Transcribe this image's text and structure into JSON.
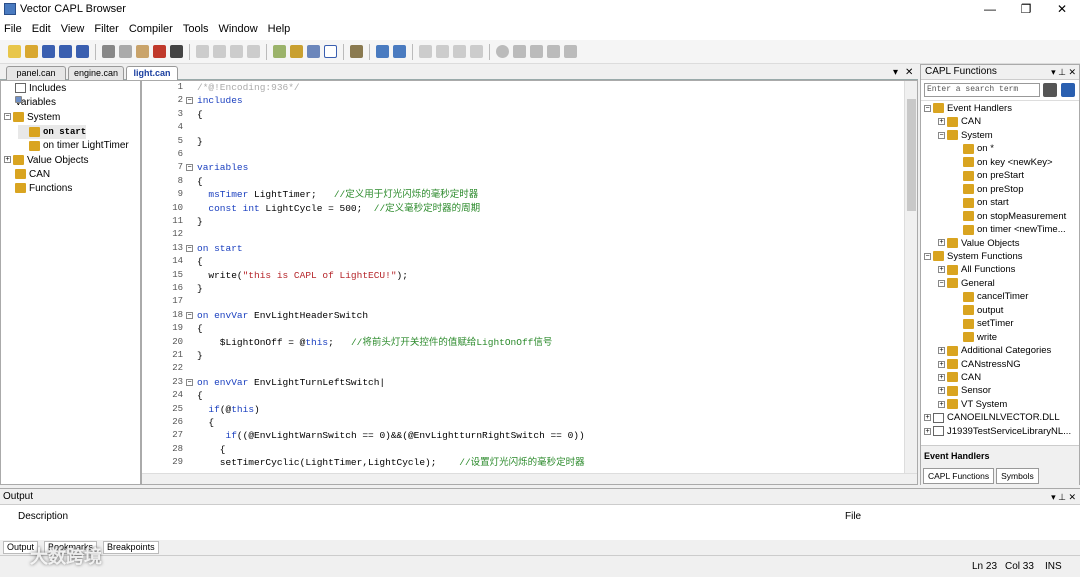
{
  "window": {
    "title": "Vector CAPL Browser",
    "controls": [
      "—",
      "❐",
      "✕"
    ]
  },
  "menu": [
    "File",
    "Edit",
    "View",
    "Filter",
    "Compiler",
    "Tools",
    "Window",
    "Help"
  ],
  "tabs": [
    {
      "label": "panel.can",
      "active": false
    },
    {
      "label": "engine.can",
      "active": false
    },
    {
      "label": "light.can",
      "active": true
    }
  ],
  "tab_controls": {
    "dropdown": "▾",
    "close": "✕"
  },
  "left_tree": [
    {
      "label": "Includes",
      "depth": 0,
      "exp": "",
      "icon": "doc"
    },
    {
      "label": "Variables",
      "depth": 0,
      "exp": "",
      "icon": "fold"
    },
    {
      "label": "System",
      "depth": 0,
      "exp": "−",
      "icon": "fx"
    },
    {
      "label": "on start",
      "depth": 1,
      "exp": "",
      "icon": "fx",
      "bold": true,
      "sel": true
    },
    {
      "label": "on timer LightTimer",
      "depth": 1,
      "exp": "",
      "icon": "fx"
    },
    {
      "label": "Value Objects",
      "depth": 0,
      "exp": "+",
      "icon": "fx"
    },
    {
      "label": "CAN",
      "depth": 0,
      "exp": "",
      "icon": "fx"
    },
    {
      "label": "Functions",
      "depth": 0,
      "exp": "",
      "icon": "fx"
    }
  ],
  "code_lines": [
    {
      "n": "1",
      "fold": "",
      "html": "<span class='pre'>/*@!Encoding:936*/</span>"
    },
    {
      "n": "2",
      "fold": "−",
      "html": "<span class='kw'>includes</span>"
    },
    {
      "n": "3",
      "fold": "",
      "html": "{"
    },
    {
      "n": "4",
      "fold": "",
      "html": ""
    },
    {
      "n": "5",
      "fold": "",
      "html": "}"
    },
    {
      "n": "6",
      "fold": "",
      "html": ""
    },
    {
      "n": "7",
      "fold": "−",
      "html": "<span class='kw'>variables</span>"
    },
    {
      "n": "8",
      "fold": "",
      "html": "{"
    },
    {
      "n": "9",
      "fold": "",
      "html": "  <span class='kw'>msTimer</span> LightTimer;   <span class='cm'>//定义用于灯光闪烁的毫秒定时器</span>"
    },
    {
      "n": "10",
      "fold": "",
      "html": "  <span class='kw'>const int</span> LightCycle = 500;  <span class='cm'>//定义毫秒定时器的周期</span>"
    },
    {
      "n": "11",
      "fold": "",
      "html": "}"
    },
    {
      "n": "12",
      "fold": "",
      "html": ""
    },
    {
      "n": "13",
      "fold": "−",
      "html": "<span class='kw'>on start</span>"
    },
    {
      "n": "14",
      "fold": "",
      "html": "{"
    },
    {
      "n": "15",
      "fold": "",
      "html": "  write(<span class='st'>\"this is CAPL of LightECU!\"</span>);"
    },
    {
      "n": "16",
      "fold": "",
      "html": "}"
    },
    {
      "n": "17",
      "fold": "",
      "html": ""
    },
    {
      "n": "18",
      "fold": "−",
      "html": "<span class='kw'>on envVar</span> EnvLightHeaderSwitch"
    },
    {
      "n": "19",
      "fold": "",
      "html": "{"
    },
    {
      "n": "20",
      "fold": "",
      "html": "    $LightOnOff = @<span class='kw'>this</span>;   <span class='cm'>//将前头灯开关控件的值赋给LightOnOff信号</span>"
    },
    {
      "n": "21",
      "fold": "",
      "html": "}"
    },
    {
      "n": "22",
      "fold": "",
      "html": ""
    },
    {
      "n": "23",
      "fold": "−",
      "html": "<span class='kw'>on envVar</span> EnvLightTurnLeftSwitch|"
    },
    {
      "n": "24",
      "fold": "",
      "html": "{"
    },
    {
      "n": "25",
      "fold": "",
      "html": "  <span class='kw'>if</span>(@<span class='kw'>this</span>)"
    },
    {
      "n": "26",
      "fold": "",
      "html": "  {"
    },
    {
      "n": "27",
      "fold": "",
      "html": "     <span class='kw'>if</span>((@EnvLightWarnSwitch == 0)&&(@EnvLightturnRightSwitch == 0))"
    },
    {
      "n": "28",
      "fold": "",
      "html": "    {"
    },
    {
      "n": "29",
      "fold": "",
      "html": "    setTimerCyclic(LightTimer,LightCycle);    <span class='cm'>//设置灯光闪烁的毫秒定时器</span>"
    }
  ],
  "right_panel": {
    "title": "CAPL Functions",
    "controls": "▾ ⊥ ✕",
    "search_placeholder": "Enter a search term",
    "tree": [
      {
        "label": "Event Handlers",
        "depth": 0,
        "exp": "−",
        "icon": "fx"
      },
      {
        "label": "CAN",
        "depth": 1,
        "exp": "+",
        "icon": "fx"
      },
      {
        "label": "System",
        "depth": 1,
        "exp": "−",
        "icon": "fx"
      },
      {
        "label": "on *",
        "depth": 2,
        "exp": "",
        "icon": "fx"
      },
      {
        "label": "on key <newKey>",
        "depth": 2,
        "exp": "",
        "icon": "fx"
      },
      {
        "label": "on preStart",
        "depth": 2,
        "exp": "",
        "icon": "fx"
      },
      {
        "label": "on preStop",
        "depth": 2,
        "exp": "",
        "icon": "fx"
      },
      {
        "label": "on start",
        "depth": 2,
        "exp": "",
        "icon": "fx"
      },
      {
        "label": "on stopMeasurement",
        "depth": 2,
        "exp": "",
        "icon": "fx"
      },
      {
        "label": "on timer <newTime...",
        "depth": 2,
        "exp": "",
        "icon": "fx"
      },
      {
        "label": "Value Objects",
        "depth": 1,
        "exp": "+",
        "icon": "fx"
      },
      {
        "label": "System Functions",
        "depth": 0,
        "exp": "−",
        "icon": "fx"
      },
      {
        "label": "All Functions",
        "depth": 1,
        "exp": "+",
        "icon": "fx"
      },
      {
        "label": "General",
        "depth": 1,
        "exp": "−",
        "icon": "fx"
      },
      {
        "label": "cancelTimer",
        "depth": 2,
        "exp": "",
        "icon": "fx"
      },
      {
        "label": "output",
        "depth": 2,
        "exp": "",
        "icon": "fx"
      },
      {
        "label": "setTimer",
        "depth": 2,
        "exp": "",
        "icon": "fx"
      },
      {
        "label": "write",
        "depth": 2,
        "exp": "",
        "icon": "fx"
      },
      {
        "label": "Additional Categories",
        "depth": 1,
        "exp": "+",
        "icon": "fx"
      },
      {
        "label": "CANstressNG",
        "depth": 1,
        "exp": "+",
        "icon": "fx"
      },
      {
        "label": "CAN",
        "depth": 1,
        "exp": "+",
        "icon": "fx"
      },
      {
        "label": "Sensor",
        "depth": 1,
        "exp": "+",
        "icon": "fx"
      },
      {
        "label": "VT System",
        "depth": 1,
        "exp": "+",
        "icon": "fx"
      },
      {
        "label": "CANOEILNLVECTOR.DLL",
        "depth": 0,
        "exp": "+",
        "icon": "doc"
      },
      {
        "label": "J1939TestServiceLibraryNL...",
        "depth": 0,
        "exp": "+",
        "icon": "doc"
      }
    ],
    "event_handlers_label": "Event Handlers",
    "tabs": [
      "CAPL Functions",
      "Symbols"
    ]
  },
  "output": {
    "title": "Output",
    "controls": "▾ ⊥ ✕",
    "col_description": "Description",
    "col_file": "File",
    "tabs": [
      "Output",
      "Bookmarks",
      "Breakpoints"
    ]
  },
  "status": {
    "line": "Ln 23",
    "col": "Col 33",
    "mode": "INS"
  },
  "watermark": "大数跨境"
}
